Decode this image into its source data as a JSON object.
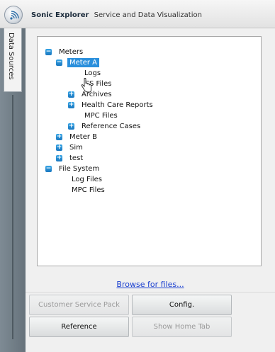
{
  "window": {
    "app_name": "Sonic Explorer",
    "subtitle": "Service and Data Visualization",
    "app_icon": "signal-waves-icon"
  },
  "side_tab": {
    "label": "Data Sources"
  },
  "tree": {
    "nodes": [
      {
        "label": "Meters",
        "level": 0,
        "toggle": "−",
        "selected": false
      },
      {
        "label": "Meter A",
        "level": 1,
        "toggle": "−",
        "selected": true
      },
      {
        "label": "Logs",
        "level": 2,
        "toggle": "",
        "selected": false
      },
      {
        "label": "CS Files",
        "level": 2,
        "toggle": "",
        "selected": false
      },
      {
        "label": "Archives",
        "level": 2,
        "toggle": "+",
        "selected": false
      },
      {
        "label": "Health Care Reports",
        "level": 2,
        "toggle": "+",
        "selected": false
      },
      {
        "label": "MPC Files",
        "level": 2,
        "toggle": "",
        "selected": false
      },
      {
        "label": "Reference Cases",
        "level": 2,
        "toggle": "+",
        "selected": false
      },
      {
        "label": "Meter B",
        "level": 1,
        "toggle": "+",
        "selected": false
      },
      {
        "label": "Sim",
        "level": 1,
        "toggle": "+",
        "selected": false
      },
      {
        "label": "test",
        "level": 1,
        "toggle": "+",
        "selected": false
      },
      {
        "label": "File System",
        "level": 0,
        "toggle": "−",
        "selected": false
      },
      {
        "label": "Log Files",
        "level": 1,
        "toggle": "",
        "selected": false
      },
      {
        "label": "MPC Files",
        "level": 1,
        "toggle": "",
        "selected": false
      }
    ]
  },
  "browse": {
    "label": "Browse for files..."
  },
  "buttons": {
    "customer_service_pack": {
      "label": "Customer Service Pack",
      "enabled": false
    },
    "config": {
      "label": "Config.",
      "enabled": true
    },
    "reference": {
      "label": "Reference",
      "enabled": true
    },
    "show_home_tab": {
      "label": "Show Home Tab",
      "enabled": false
    }
  },
  "colors": {
    "selection": "#2a8fdc",
    "toggle": "#1e88d4",
    "link": "#1a3fd0",
    "side_strip": "#6f7b84"
  }
}
